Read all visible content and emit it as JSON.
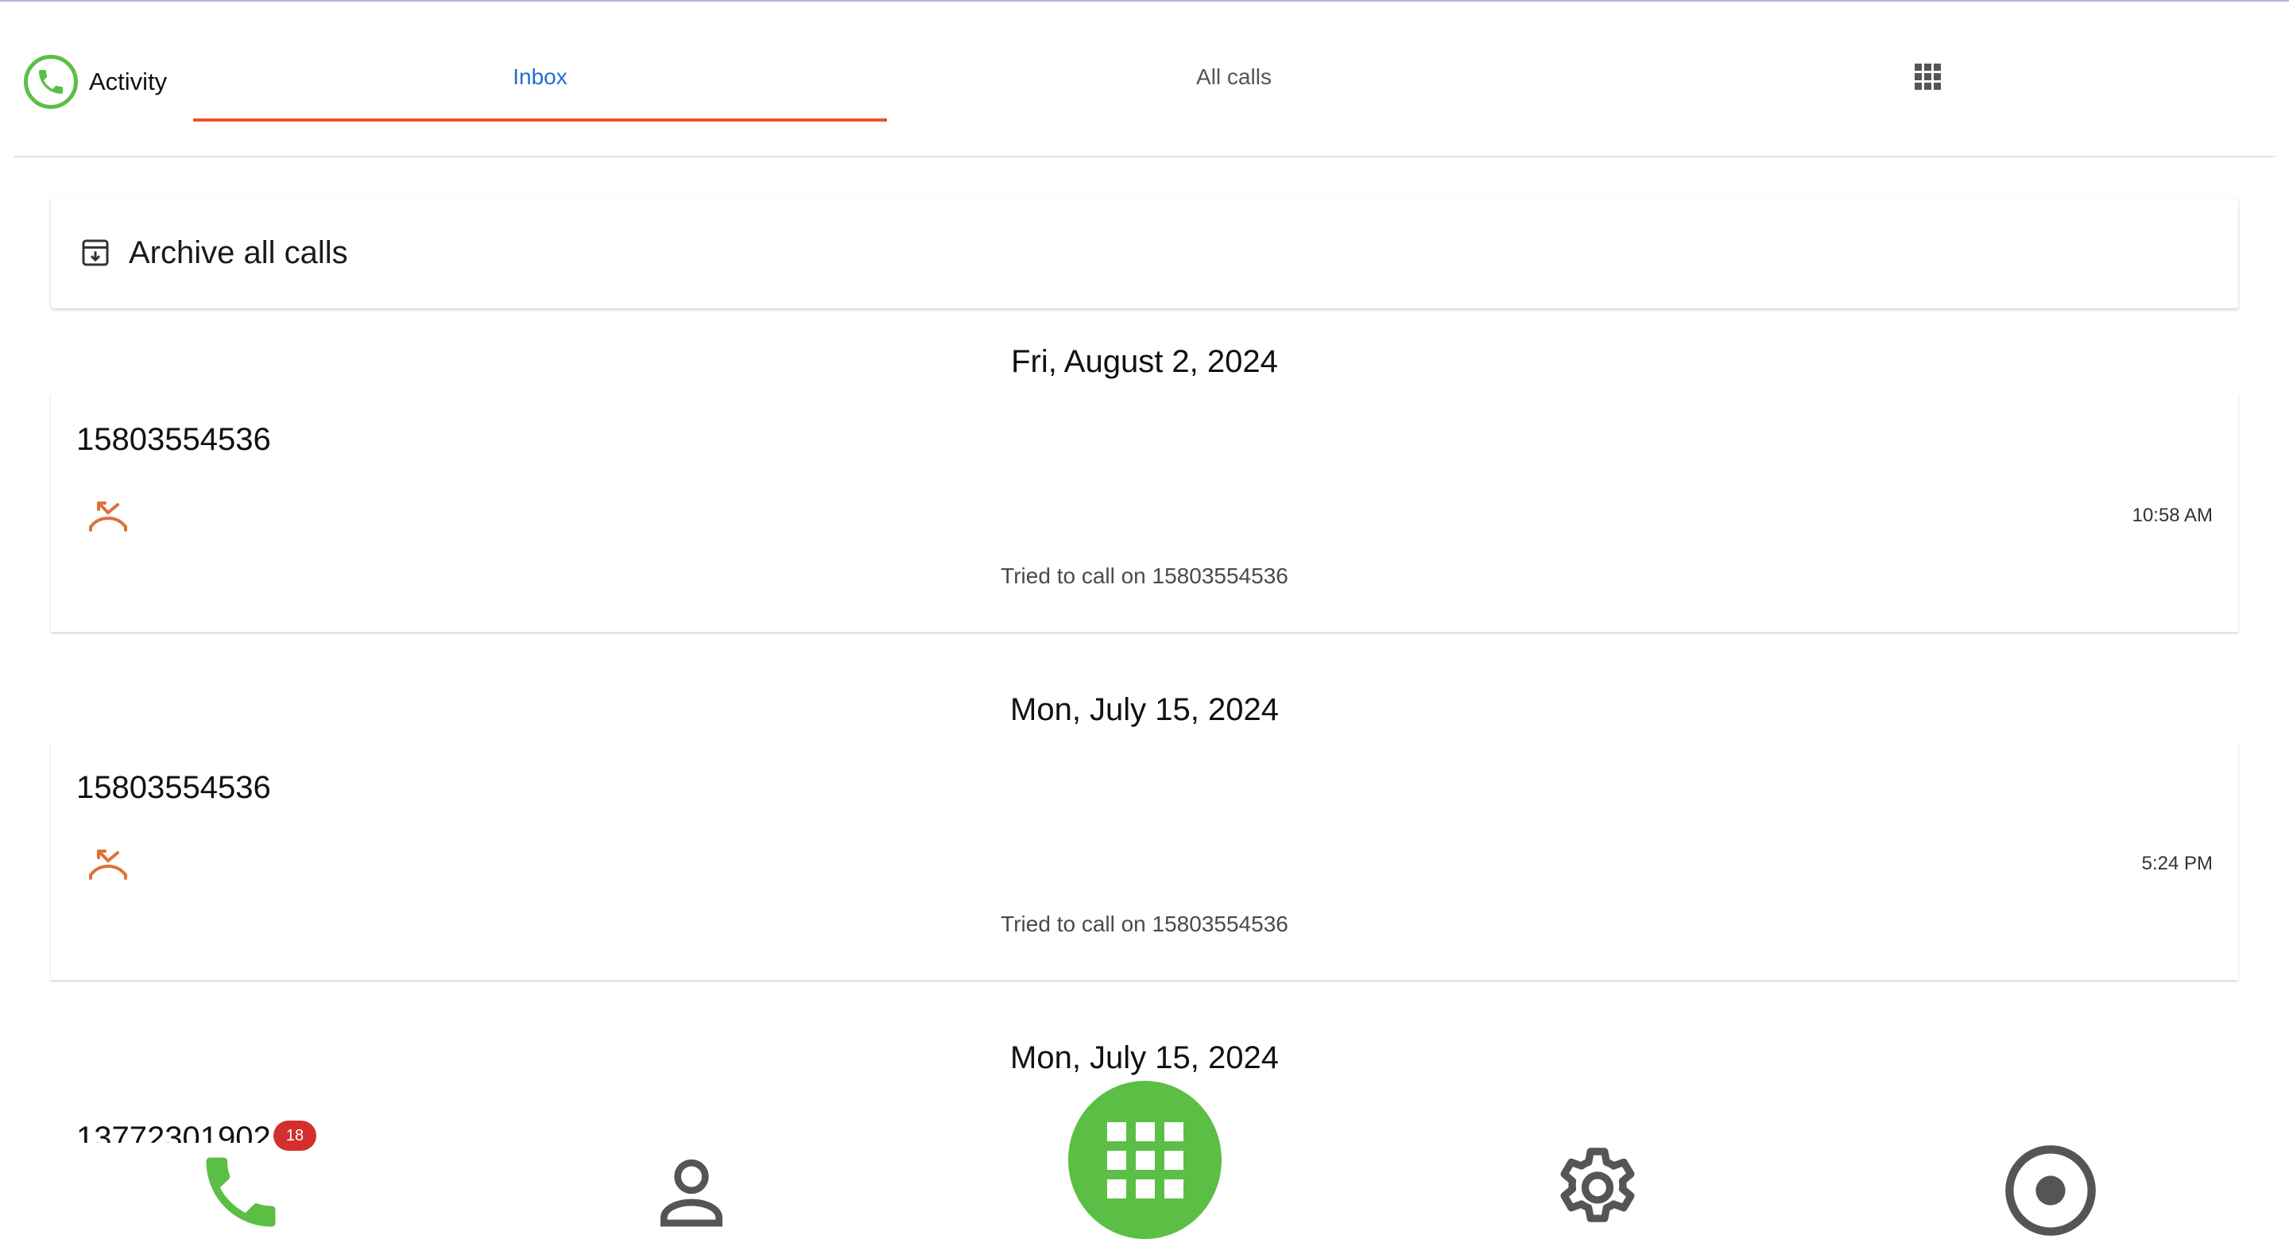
{
  "colors": {
    "accent_green": "#5cbf45",
    "tab_active": "#1f6fd0",
    "tab_indicator": "#e8552d",
    "missed_call": "#e0703a",
    "badge": "#d32f2f"
  },
  "header": {
    "title": "Activity",
    "logo_icon": "phone-circle-icon",
    "tabs": [
      {
        "label": "Inbox",
        "active": true
      },
      {
        "label": "All calls",
        "active": false
      },
      {
        "icon": "grid-icon",
        "active": false
      }
    ]
  },
  "archive": {
    "label": "Archive all calls",
    "icon": "archive-icon"
  },
  "groups": [
    {
      "date": "Fri, August 2, 2024",
      "calls": [
        {
          "number": "15803554536",
          "status_icon": "missed-call-icon",
          "time": "10:58 AM",
          "description": "Tried to call on 15803554536"
        }
      ]
    },
    {
      "date": "Mon, July 15, 2024",
      "calls": [
        {
          "number": "15803554536",
          "status_icon": "missed-call-icon",
          "time": "5:24 PM",
          "description": "Tried to call on 15803554536"
        }
      ]
    },
    {
      "date": "Mon, July 15, 2024",
      "calls": [
        {
          "number": "13772301902"
        }
      ]
    }
  ],
  "bottom_nav": {
    "items": [
      {
        "name": "calls",
        "icon": "phone-icon",
        "badge": "18"
      },
      {
        "name": "contacts",
        "icon": "person-icon"
      },
      {
        "name": "dialpad",
        "icon": "dialpad-icon"
      },
      {
        "name": "settings",
        "icon": "gear-icon"
      },
      {
        "name": "record",
        "icon": "record-icon"
      }
    ]
  }
}
